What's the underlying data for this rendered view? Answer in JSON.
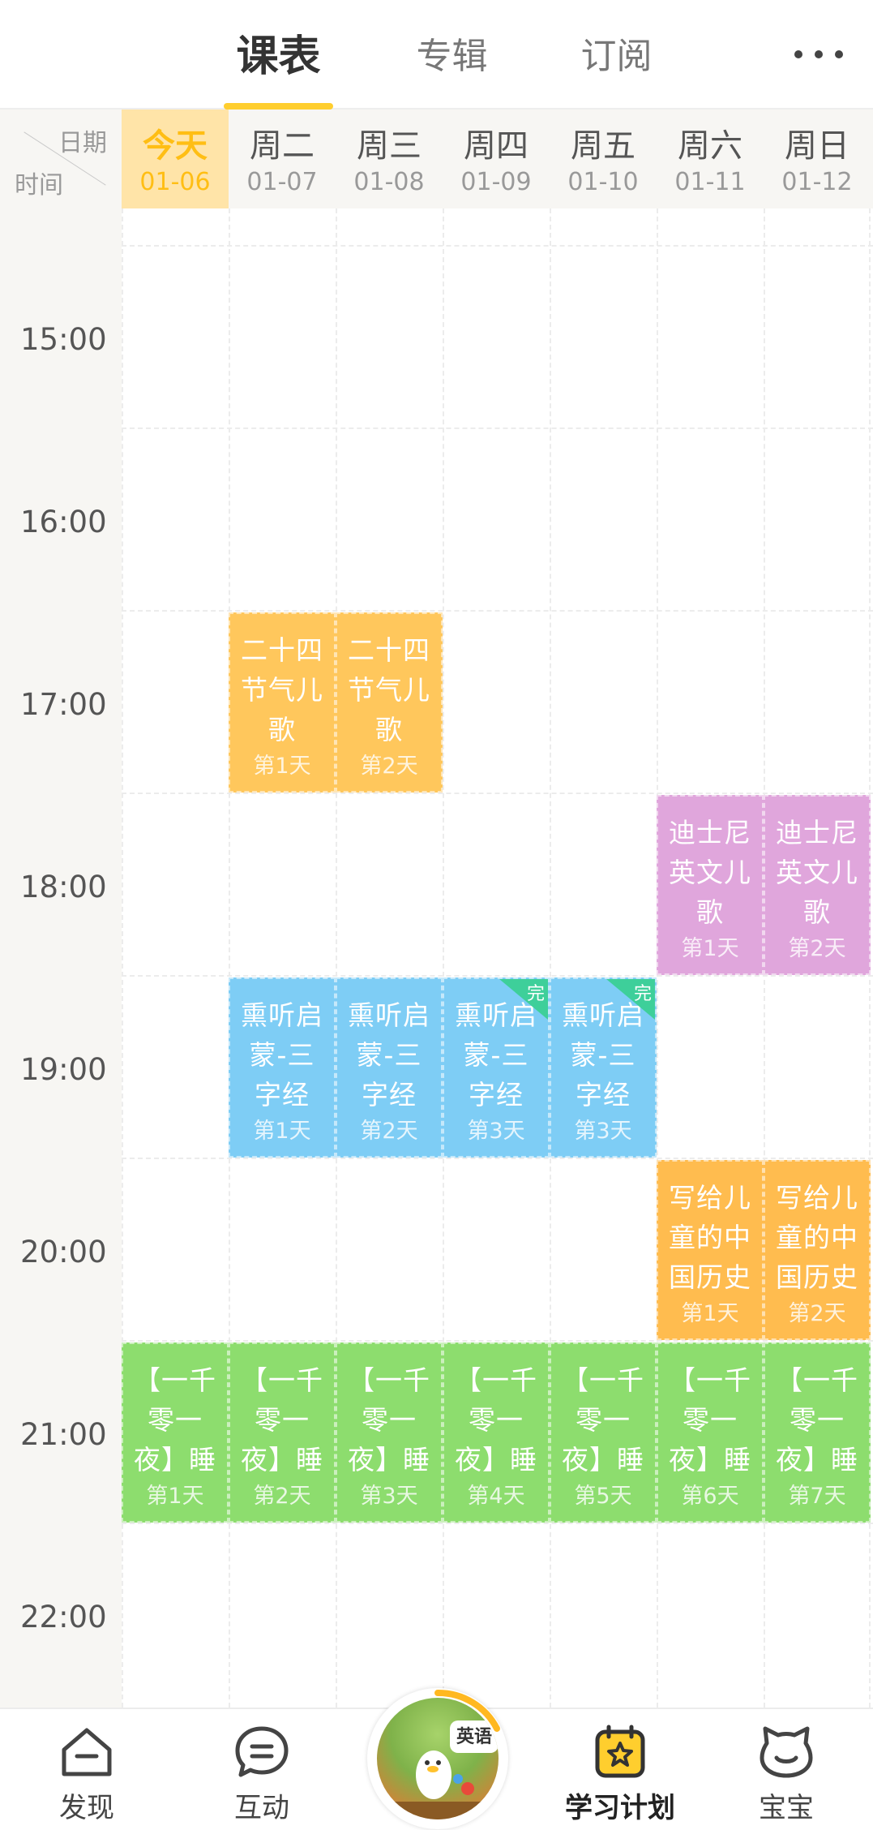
{
  "tabs": [
    {
      "label": "课表",
      "active": true
    },
    {
      "label": "专辑",
      "active": false
    },
    {
      "label": "订阅",
      "active": false
    }
  ],
  "header": {
    "corner_date": "日期",
    "corner_time": "时间",
    "days": [
      {
        "name": "今天",
        "date": "01-06",
        "today": true
      },
      {
        "name": "周二",
        "date": "01-07"
      },
      {
        "name": "周三",
        "date": "01-08"
      },
      {
        "name": "周四",
        "date": "01-09"
      },
      {
        "name": "周五",
        "date": "01-10"
      },
      {
        "name": "周六",
        "date": "01-11"
      },
      {
        "name": "周日",
        "date": "01-12"
      }
    ]
  },
  "times": [
    "15:00",
    "16:00",
    "17:00",
    "18:00",
    "19:00",
    "20:00",
    "21:00",
    "22:00"
  ],
  "blocks": {
    "jieqi": {
      "title": "二十四节气儿歌",
      "day1": "第1天",
      "day2": "第2天"
    },
    "disney": {
      "title": "迪士尼英文儿歌",
      "day1": "第1天",
      "day2": "第2天"
    },
    "sanzijing": {
      "title": "熏听启蒙-三字经",
      "day1": "第1天",
      "day2": "第2天",
      "day3": "第3天",
      "day3b": "第3天",
      "done": "完"
    },
    "history": {
      "title": "写给儿童的中国历史",
      "day1": "第1天",
      "day2": "第2天"
    },
    "night": {
      "title": "【一千零一夜】睡",
      "days": [
        "第1天",
        "第2天",
        "第3天",
        "第4天",
        "第5天",
        "第6天",
        "第7天"
      ]
    }
  },
  "nav": {
    "discover": "发现",
    "interact": "互动",
    "center_tag": "英语",
    "plan": "学习计划",
    "baby": "宝宝"
  },
  "colors": {
    "accent": "#ffce2e",
    "today_bg": "#ffe4a8",
    "orange": "#ffc75c",
    "purple": "#e0a6dc",
    "blue": "#7ecdf5",
    "green": "#8ddd6e",
    "done_tag": "#3ecf9a"
  }
}
